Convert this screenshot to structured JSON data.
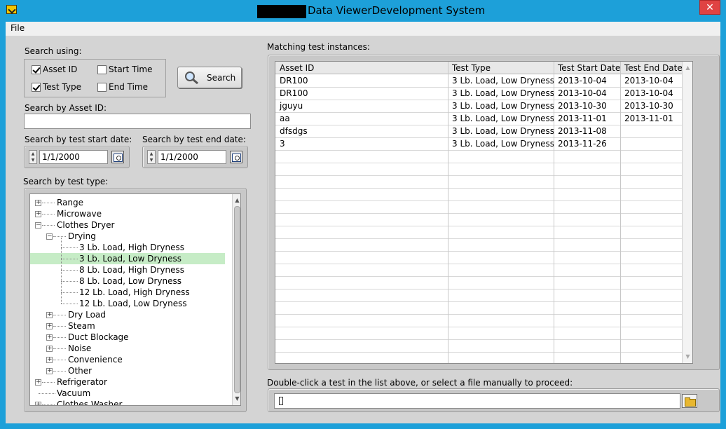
{
  "window": {
    "title": "Data ViewerDevelopment System",
    "close_glyph": "✕"
  },
  "menu": {
    "file": "File"
  },
  "search_using": {
    "label": "Search using:",
    "asset_id": "Asset ID",
    "test_type": "Test Type",
    "start_time": "Start Time",
    "end_time": "End Time",
    "asset_id_checked": true,
    "test_type_checked": true,
    "start_time_checked": false,
    "end_time_checked": false
  },
  "search_button": {
    "label": "Search",
    "icon": "magnifier-icon"
  },
  "asset_search": {
    "label": "Search by Asset ID:",
    "value": ""
  },
  "start_date": {
    "label": "Search by test start date:",
    "value": "1/1/2000"
  },
  "end_date": {
    "label": "Search by test end date:",
    "value": "1/1/2000"
  },
  "test_type_tree": {
    "label": "Search by test type:",
    "items": [
      {
        "label": "Range"
      },
      {
        "label": "Microwave"
      },
      {
        "label": "Clothes Dryer"
      },
      {
        "label": "Drying"
      },
      {
        "label": "3 Lb. Load, High Dryness"
      },
      {
        "label": "3 Lb. Load, Low Dryness"
      },
      {
        "label": "8 Lb. Load, High Dryness"
      },
      {
        "label": "8 Lb. Load, Low Dryness"
      },
      {
        "label": "12 Lb. Load, High Dryness"
      },
      {
        "label": "12 Lb. Load, Low Dryness"
      },
      {
        "label": "Dry Load"
      },
      {
        "label": "Steam"
      },
      {
        "label": "Duct Blockage"
      },
      {
        "label": "Noise"
      },
      {
        "label": "Convenience"
      },
      {
        "label": "Other"
      },
      {
        "label": "Refrigerator"
      },
      {
        "label": "Vacuum"
      },
      {
        "label": "Clothes Washer"
      }
    ],
    "selected": "3 Lb. Load, Low Dryness"
  },
  "results": {
    "label": "Matching test instances:",
    "columns": [
      "Asset ID",
      "Test Type",
      "Test Start Date",
      "Test End Date"
    ],
    "rows": [
      [
        "DR100",
        "3 Lb. Load, Low Dryness",
        "2013-10-04",
        "2013-10-04"
      ],
      [
        "DR100",
        "3 Lb. Load, Low Dryness",
        "2013-10-04",
        "2013-10-04"
      ],
      [
        "jguyu",
        "3 Lb. Load, Low Dryness",
        "2013-10-30",
        "2013-10-30"
      ],
      [
        "aa",
        "3 Lb. Load, Low Dryness",
        "2013-11-01",
        "2013-11-01"
      ],
      [
        "dfsdgs",
        "3 Lb. Load, Low Dryness",
        "2013-11-08",
        ""
      ],
      [
        "3",
        "3 Lb. Load, Low Dryness",
        "2013-11-26",
        ""
      ]
    ]
  },
  "file_select": {
    "label": "Double-click a test in the list above, or select a file manually to proceed:",
    "value": ""
  }
}
